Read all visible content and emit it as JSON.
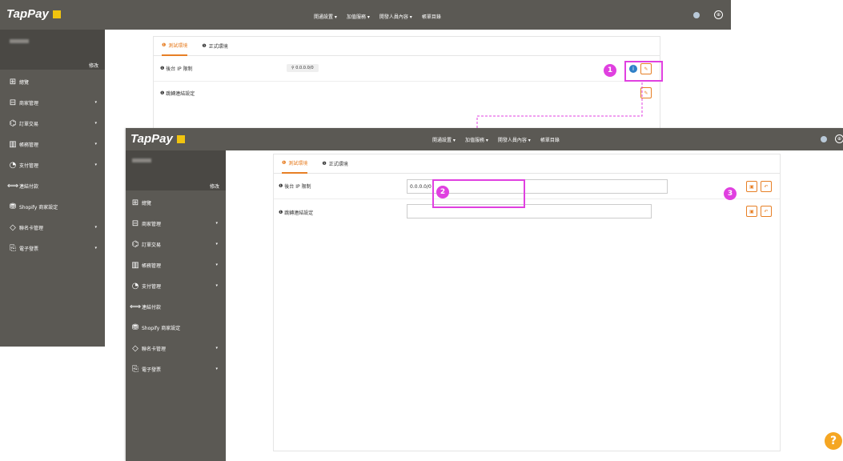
{
  "brand": {
    "name": "TapPay"
  },
  "topmenu": [
    {
      "label": "開通設置",
      "has_caret": true
    },
    {
      "label": "加值服務",
      "has_caret": true
    },
    {
      "label": "開發人員內容",
      "has_caret": true
    },
    {
      "label": "帳單目錄",
      "has_caret": false
    }
  ],
  "user": {
    "edit_label": "修改"
  },
  "sidebar": {
    "items": [
      {
        "label": "總覽",
        "icon": "dashboard-icon",
        "glyph": "⊞",
        "caret": false
      },
      {
        "label": "商家管理",
        "icon": "store-icon",
        "glyph": "⊟",
        "caret": true
      },
      {
        "label": "訂單交易",
        "icon": "orders-icon",
        "glyph": "⌬",
        "caret": true
      },
      {
        "label": "帳務管理",
        "icon": "accounting-icon",
        "glyph": "▥",
        "caret": true
      },
      {
        "label": "支付管理",
        "icon": "payment-icon",
        "glyph": "◔",
        "caret": true
      },
      {
        "label": "連結付款",
        "icon": "link-icon",
        "glyph": "⟺",
        "caret": false
      },
      {
        "label": "Shopify 商家設定",
        "icon": "shopify-icon",
        "glyph": "⛃",
        "caret": false
      },
      {
        "label": "聯名卡管理",
        "icon": "cobrand-card-icon",
        "glyph": "◇",
        "caret": true
      },
      {
        "label": "電子發票",
        "icon": "invoice-icon",
        "glyph": "⎘",
        "caret": true
      }
    ]
  },
  "tabs": [
    {
      "label": "測試環境",
      "active": true
    },
    {
      "label": "正式環境",
      "active": false
    }
  ],
  "back_window": {
    "rows": [
      {
        "label": "後台 IP 限制",
        "chip": "0.0.0.0/0"
      },
      {
        "label": "跳轉連結設定",
        "chip": ""
      }
    ]
  },
  "front_window": {
    "rows": [
      {
        "label": "後台 IP 限制",
        "value": "0.0.0.0/0"
      },
      {
        "label": "跳轉連結設定",
        "value": ""
      }
    ]
  },
  "annotations": {
    "one": "1",
    "two": "2",
    "three": "3"
  },
  "help": {
    "label": "?"
  },
  "colors": {
    "accent": "#e77f25",
    "topbar": "#5b5954",
    "highlight": "#e040e0",
    "info": "#2f80c8"
  }
}
